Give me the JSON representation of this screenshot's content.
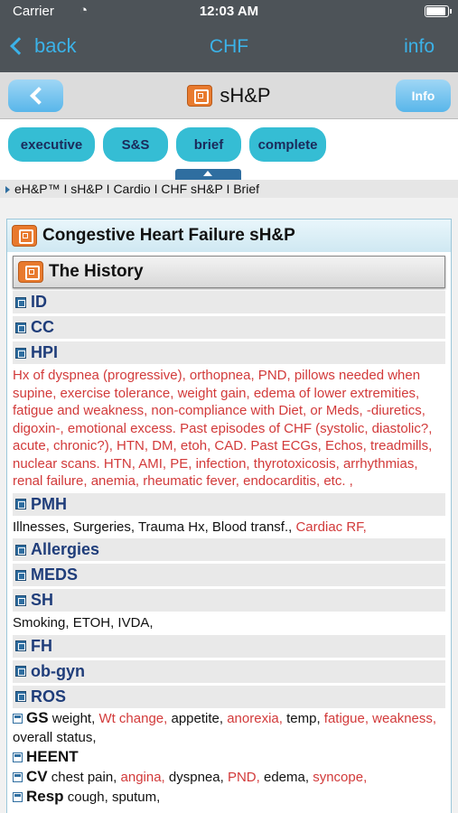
{
  "status": {
    "carrier": "Carrier",
    "time": "12:03 AM"
  },
  "nav": {
    "back_label": "back",
    "title": "CHF",
    "info_label": "info"
  },
  "toolbar": {
    "title": "sH&P",
    "info_label": "Info"
  },
  "tabs": [
    "executive",
    "S&S",
    "brief",
    "complete"
  ],
  "breadcrumb": "eH&P™ I sH&P I Cardio I CHF sH&P I Brief",
  "panel": {
    "title": "Congestive Heart Failure sH&P",
    "history_title": "The History",
    "sections": {
      "id": "ID",
      "cc": "CC",
      "hpi": "HPI",
      "hpi_text": "Hx of dyspnea (progressive), orthopnea, PND, pillows needed when supine, exercise tolerance, weight gain, edema of lower extremities, fatigue and weakness, non-compliance with Diet, or Meds, -diuretics, digoxin-, emotional excess. Past episodes of CHF (systolic, diastolic?, acute, chronic?), HTN, DM, etoh, CAD. Past ECGs, Echos, treadmills, nuclear scans. HTN, AMI, PE, infection, thyrotoxicosis, arrhythmias, renal failure, anemia, rheumatic fever, endocarditis, etc. ,",
      "pmh": "PMH",
      "pmh_text_plain": "Illnesses, Surgeries, Trauma Hx, Blood transf.,",
      "pmh_text_red": "Cardiac RF,",
      "allergies": "Allergies",
      "meds": "MEDS",
      "sh": "SH",
      "sh_text": "Smoking, ETOH, IVDA,",
      "fh": "FH",
      "obgyn": "ob-gyn",
      "ros": "ROS"
    },
    "ros": {
      "gs_head": "GS",
      "gs_1": "weight,",
      "gs_2": "Wt change,",
      "gs_3": "appetite,",
      "gs_4": "anorexia,",
      "gs_5": "temp,",
      "gs_6": "fatigue,",
      "gs_7": "weakness,",
      "gs_8": "overall status,",
      "heent_head": "HEENT",
      "cv_head": "CV",
      "cv_1": "chest pain,",
      "cv_2": "angina,",
      "cv_3": "dyspnea,",
      "cv_4": "PND,",
      "cv_5": "edema,",
      "cv_6": "syncope,",
      "resp_head": "Resp",
      "resp_1": "cough, sputum,"
    }
  }
}
